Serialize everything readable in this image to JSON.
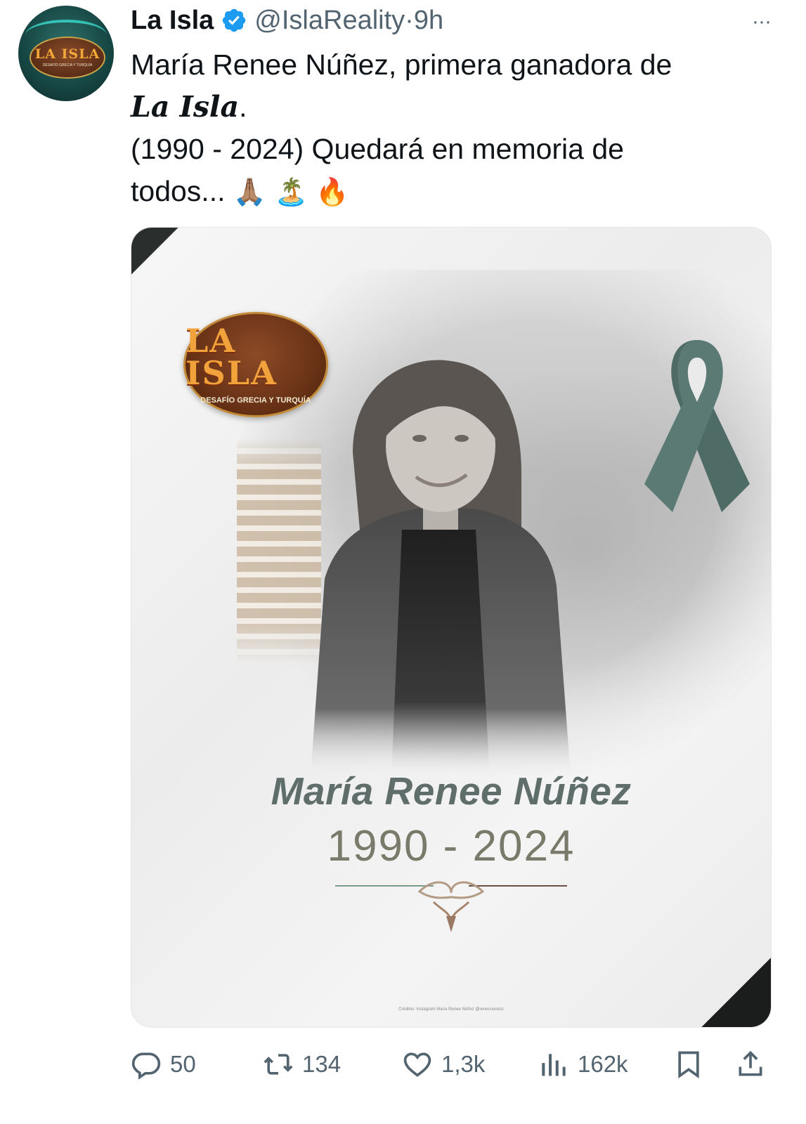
{
  "account": {
    "name": "La Isla",
    "handle": "@IslaReality",
    "separator": "·",
    "time": "9h",
    "verified": true,
    "more": "···",
    "avatar": {
      "title": "LA ISLA",
      "subtitle": "DESAFÍO GRECIA Y TURQUÍA"
    }
  },
  "tweet": {
    "line1": "María Renee Núñez, primera ganadora de",
    "line2_em": "La Isla",
    "line2_tail": ".",
    "line3": "(1990 - 2024) Quedará en memoria de",
    "line4": "todos...",
    "emojis": [
      "🙏🏽",
      "🏝️",
      "🔥"
    ]
  },
  "media": {
    "logo_title": "LA ISLA",
    "logo_subtitle": "DESAFÍO GRECIA Y TURQUÍA",
    "name": "María Renee Núñez",
    "years": "1990 - 2024",
    "credits": "Créditos: Instagram María Renee Núñez @renecnunezc"
  },
  "actions": {
    "replies": "50",
    "reposts": "134",
    "likes": "1,3k",
    "views": "162k"
  },
  "colors": {
    "text": "#0f1419",
    "secondary": "#536471",
    "verified": "#1d9bf0",
    "ribbon": "#4f6b66"
  }
}
